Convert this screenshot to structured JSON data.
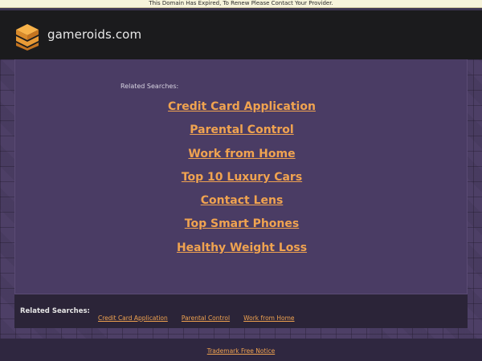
{
  "notice": {
    "text": "This Domain Has Expired, To Renew Please Contact Your Provider."
  },
  "header": {
    "site_name": "gameroids.com",
    "logo_icon": "stacked-layers-logo-icon"
  },
  "main": {
    "related_label": "Related Searches:",
    "links": [
      "Credit Card Application",
      "Parental Control",
      "Work from Home",
      "Top 10 Luxury Cars",
      "Contact Lens",
      "Top Smart Phones",
      "Healthy Weight Loss"
    ]
  },
  "footer_related": {
    "label": "Related Searches:",
    "links": [
      "Credit Card Application",
      "Parental Control",
      "Work from Home"
    ]
  },
  "bottom": {
    "trademark": "Trademark Free Notice"
  },
  "colors": {
    "link": "#f0a350",
    "header_bg": "#1b1b1d",
    "page_bg": "#4d3f66",
    "notice_bg": "#f6f3da"
  }
}
